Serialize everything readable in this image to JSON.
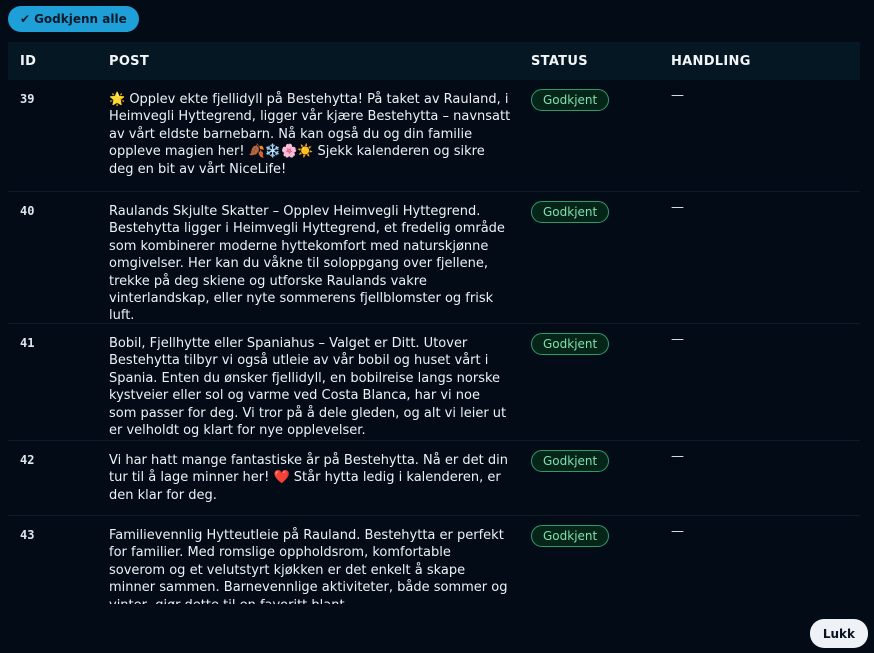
{
  "toolbar": {
    "approve_all_label": "Godkjenn alle",
    "approve_all_icon": "check-icon"
  },
  "table": {
    "columns": {
      "id": "ID",
      "post": "POST",
      "status": "STATUS",
      "handling": "HANDLING"
    },
    "rows": [
      {
        "id": "39",
        "post": "🌟 Opplev ekte fjellidyll på Bestehytta! På taket av Rauland, i Heimvegli Hyttegrend, ligger vår kjære Bestehytta – navnsatt av vårt eldste barnebarn. Nå kan også du og din familie oppleve magien her! 🍂❄️🌸☀️ Sjekk kalenderen og sikre deg en bit av vårt NiceLife!",
        "status": "Godkjent",
        "handling": "—"
      },
      {
        "id": "40",
        "post": "Raulands Skjulte Skatter – Opplev Heimvegli Hyttegrend. Bestehytta ligger i Heimvegli Hyttegrend, et fredelig område som kombinerer moderne hyttekomfort med naturskjønne omgivelser. Her kan du våkne til soloppgang over fjellene, trekke på deg skiene og utforske Raulands vakre vinterlandskap, eller nyte sommerens fjellblomster og frisk luft.",
        "status": "Godkjent",
        "handling": "—"
      },
      {
        "id": "41",
        "post": "Bobil, Fjellhytte eller Spaniahus – Valget er Ditt. Utover Bestehytta tilbyr vi også utleie av vår bobil og huset vårt i Spania. Enten du ønsker fjellidyll, en bobilreise langs norske kystveier eller sol og varme ved Costa Blanca, har vi noe som passer for deg. Vi tror på å dele gleden, og alt vi leier ut er velholdt og klart for nye opplevelser.",
        "status": "Godkjent",
        "handling": "—"
      },
      {
        "id": "42",
        "post": "Vi har hatt mange fantastiske år på Bestehytta. Nå er det din tur til å lage minner her! ❤️ Står hytta ledig i kalenderen, er den klar for deg.",
        "status": "Godkjent",
        "handling": "—"
      },
      {
        "id": "43",
        "post": "Familievennlig Hytteutleie på Rauland. Bestehytta er perfekt for familier. Med romslige oppholdsrom, komfortable soverom og et velutstyrt kjøkken er det enkelt å skape minner sammen. Barnevennlige aktiviteter, både sommer og vinter, gjør dette til en favoritt blant",
        "status": "Godkjent",
        "handling": "—"
      }
    ]
  },
  "footer": {
    "close_label": "Lukk"
  },
  "colors": {
    "background": "#020b16",
    "header_bg": "#061724",
    "accent": "#1e9fd8",
    "badge_border": "#2f9b6c",
    "badge_text": "#7fe0b0"
  }
}
